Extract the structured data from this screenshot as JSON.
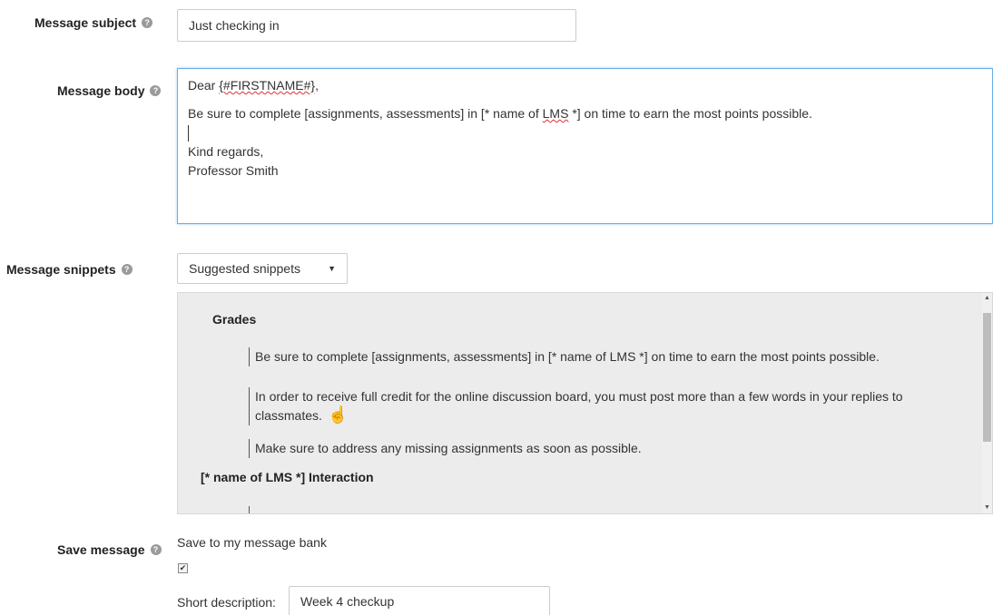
{
  "fields": {
    "subject": {
      "label": "Message subject",
      "value": "Just checking in"
    },
    "body": {
      "label": "Message body",
      "greeting_prefix": "Dear ",
      "greeting_token": "{#FIRSTNAME#}",
      "greeting_suffix": ",",
      "line1_prefix": "Be sure to complete [assignments, assessments] in [* name of ",
      "line1_spell": "LMS",
      "line1_suffix": " *] on time to earn the most points possible.",
      "closing": "Kind regards,",
      "signature": "Professor Smith"
    },
    "snippets": {
      "label": "Message snippets",
      "selected": "Suggested snippets",
      "groups": [
        {
          "title": "Grades",
          "items": [
            "Be sure to complete [assignments, assessments] in [* name of LMS *] on time to earn the most points possible.",
            "In order to receive full credit for the online discussion board, you must post more than a few words in your replies to classmates.",
            "Make sure to address any missing assignments as soon as possible."
          ]
        },
        {
          "title": "[* name of LMS *] Interaction",
          "items": []
        }
      ]
    },
    "save": {
      "label": "Save message",
      "option_text": "Save to my message bank",
      "checked": true,
      "short_desc_label": "Short description:",
      "short_desc_value": "Week 4 checkup"
    }
  },
  "icons": {
    "help": "help-icon",
    "dropdown": "caret-down-icon",
    "pointer": "hand-pointer-icon"
  }
}
